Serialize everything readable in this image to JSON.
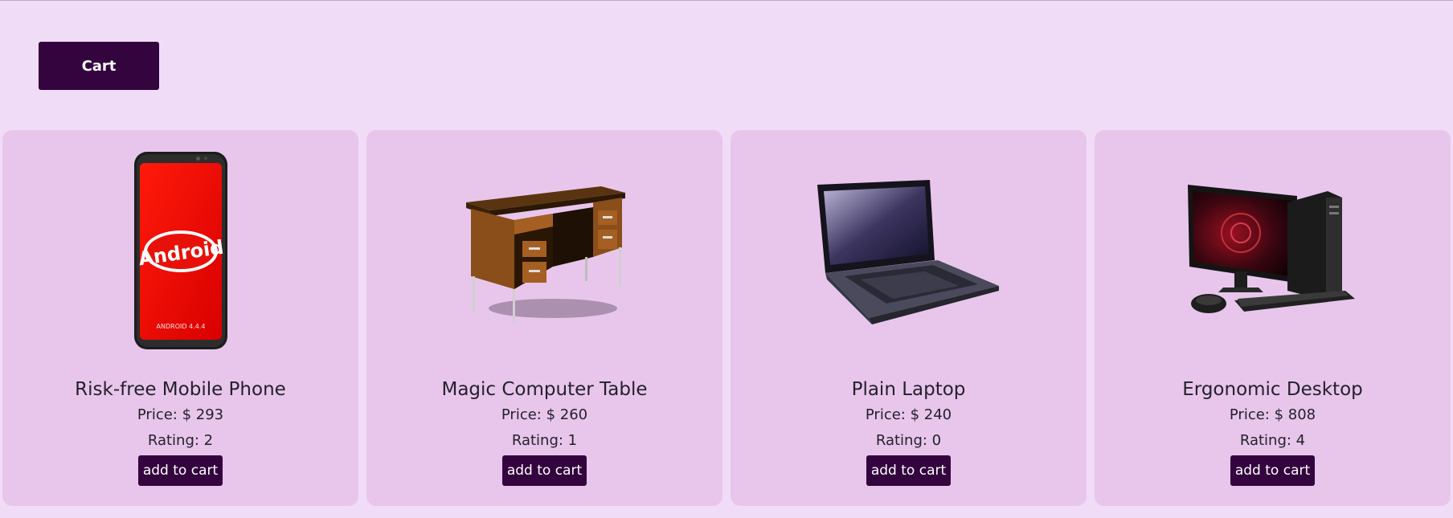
{
  "header": {
    "cart_label": "Cart"
  },
  "products": [
    {
      "name": "Risk-free Mobile Phone",
      "price_label": "Price: $ 293",
      "rating_label": "Rating: 2",
      "button_label": "add to cart",
      "image_icon": "mobile-phone-icon",
      "screen_brand": "Android",
      "screen_caption": "ANDROID 4.4.4"
    },
    {
      "name": "Magic Computer Table",
      "price_label": "Price: $ 260",
      "rating_label": "Rating: 1",
      "button_label": "add to cart",
      "image_icon": "computer-desk-icon"
    },
    {
      "name": "Plain Laptop",
      "price_label": "Price: $ 240",
      "rating_label": "Rating: 0",
      "button_label": "add to cart",
      "image_icon": "laptop-icon"
    },
    {
      "name": "Ergonomic Desktop",
      "price_label": "Price: $ 808",
      "rating_label": "Rating: 4",
      "button_label": "add to cart",
      "image_icon": "desktop-computer-icon"
    }
  ],
  "colors": {
    "background": "#f1dcf8",
    "card": "#e8c6ec",
    "button": "#33043e",
    "button_text": "#ffffff"
  }
}
